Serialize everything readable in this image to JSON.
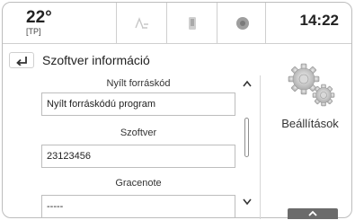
{
  "status": {
    "temperature": "22°",
    "temperature_sub": "[TP]",
    "time": "14:22",
    "buttons": [
      "radio-icon",
      "phone-icon",
      "connected-icon"
    ]
  },
  "header": {
    "title": "Szoftver információ"
  },
  "sections": [
    {
      "label": "Nyílt forráskód",
      "value": "Nyílt forráskódú program"
    },
    {
      "label": "Szoftver",
      "value": "23123456"
    },
    {
      "label": "Gracenote",
      "value": "-----"
    }
  ],
  "sidebar": {
    "settings_label": "Beállítások",
    "icon": "gears-icon"
  },
  "colors": {
    "border": "#cfcfcf",
    "bottom_button": "#6b6b6b"
  }
}
